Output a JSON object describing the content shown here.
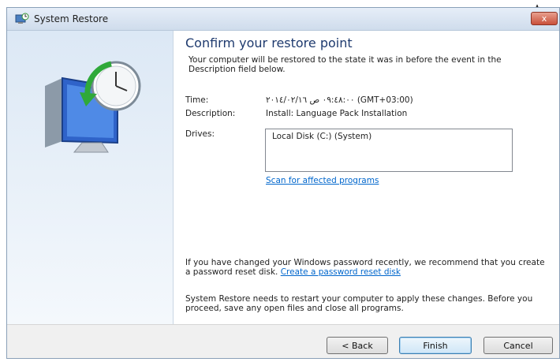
{
  "window": {
    "title": "System Restore",
    "close_label": "x",
    "stray_glyph": "ﯿ"
  },
  "icons": {
    "title": "system-restore-icon",
    "hero": "monitor-clock-restore-icon"
  },
  "main": {
    "heading": "Confirm your restore point",
    "intro": "Your computer will be restored to the state it was in before the event in the Description field below.",
    "time_label": "Time:",
    "time_value": "٠٩:٤٨:٠٠ ص ٢٠١٤/٠٢/١٦ (GMT+03:00)",
    "description_label": "Description:",
    "description_value": "Install: Language Pack Installation",
    "drives_label": "Drives:",
    "drives": [
      "Local Disk (C:) (System)"
    ],
    "scan_link": "Scan for affected programs",
    "password_text": "If you have changed your Windows password recently, we recommend that you create a password reset disk.",
    "password_link": "Create a password reset disk",
    "restart_text": "System Restore needs to restart your computer to apply these changes. Before you proceed, save any open files and close all programs."
  },
  "footer": {
    "back": "< Back",
    "finish": "Finish",
    "cancel": "Cancel"
  }
}
